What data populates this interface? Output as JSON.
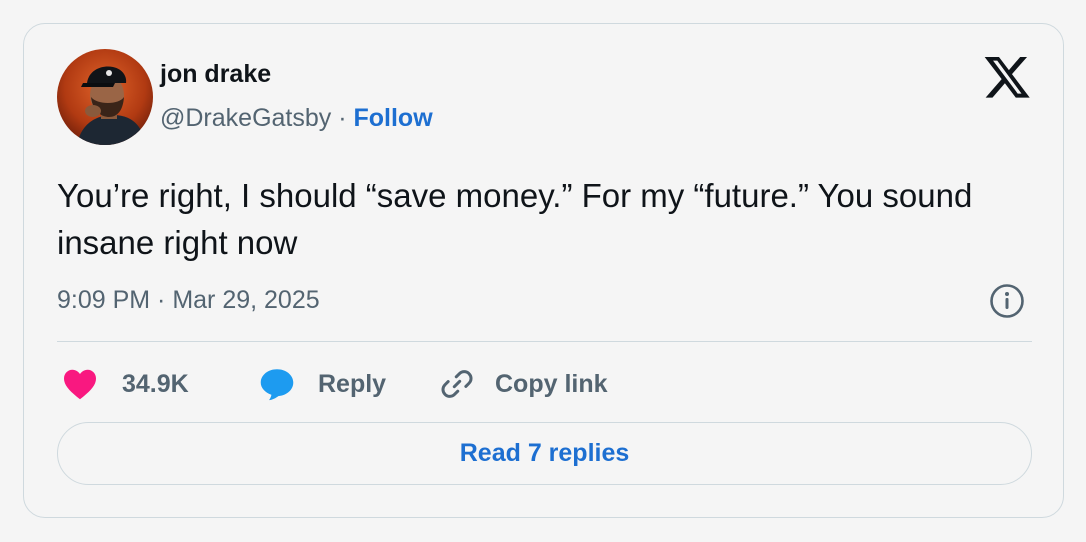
{
  "author": {
    "name": "jon drake",
    "handle": "@DrakeGatsby",
    "separator": " · ",
    "follow_label": "Follow"
  },
  "brand_icon": "x-logo-icon",
  "tweet": {
    "text": "You’re right, I should “save money.” For my “future.” You sound insane right now",
    "timestamp": "9:09 PM · Mar 29, 2025"
  },
  "actions": {
    "like_count": "34.9K",
    "reply_label": "Reply",
    "copy_link_label": "Copy link"
  },
  "read_replies_label": "Read 7 replies",
  "colors": {
    "like": "#f91880",
    "reply": "#1d9bf0",
    "link": "#1d6fd1",
    "muted_text": "#536471",
    "border": "#cfd9de"
  }
}
